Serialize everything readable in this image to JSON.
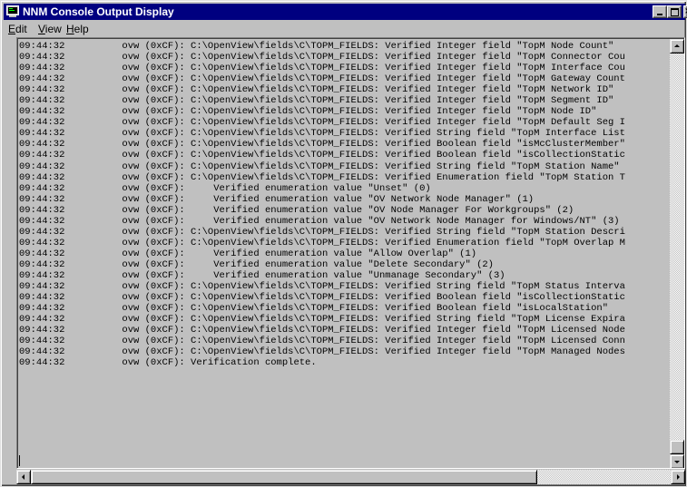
{
  "window": {
    "title": "NNM Console Output Display",
    "titlebar_color": "#000080"
  },
  "menu": {
    "items": [
      {
        "label": "Edit",
        "accel": "E"
      },
      {
        "label": "View",
        "accel": "V"
      },
      {
        "label": "Help",
        "accel": "H"
      }
    ]
  },
  "log_lines": [
    "09:44:32          ovw (0xCF): C:\\OpenView\\fields\\C\\TOPM_FIELDS: Verified Integer field \"TopM Node Count\"",
    "09:44:32          ovw (0xCF): C:\\OpenView\\fields\\C\\TOPM_FIELDS: Verified Integer field \"TopM Connector Cou",
    "09:44:32          ovw (0xCF): C:\\OpenView\\fields\\C\\TOPM_FIELDS: Verified Integer field \"TopM Interface Cou",
    "09:44:32          ovw (0xCF): C:\\OpenView\\fields\\C\\TOPM_FIELDS: Verified Integer field \"TopM Gateway Count",
    "09:44:32          ovw (0xCF): C:\\OpenView\\fields\\C\\TOPM_FIELDS: Verified Integer field \"TopM Network ID\"",
    "09:44:32          ovw (0xCF): C:\\OpenView\\fields\\C\\TOPM_FIELDS: Verified Integer field \"TopM Segment ID\"",
    "09:44:32          ovw (0xCF): C:\\OpenView\\fields\\C\\TOPM_FIELDS: Verified Integer field \"TopM Node ID\"",
    "09:44:32          ovw (0xCF): C:\\OpenView\\fields\\C\\TOPM_FIELDS: Verified Integer field \"TopM Default Seg I",
    "09:44:32          ovw (0xCF): C:\\OpenView\\fields\\C\\TOPM_FIELDS: Verified String field \"TopM Interface List",
    "09:44:32          ovw (0xCF): C:\\OpenView\\fields\\C\\TOPM_FIELDS: Verified Boolean field \"isMcClusterMember\"",
    "09:44:32          ovw (0xCF): C:\\OpenView\\fields\\C\\TOPM_FIELDS: Verified Boolean field \"isCollectionStatic",
    "09:44:32          ovw (0xCF): C:\\OpenView\\fields\\C\\TOPM_FIELDS: Verified String field \"TopM Station Name\"",
    "09:44:32          ovw (0xCF): C:\\OpenView\\fields\\C\\TOPM_FIELDS: Verified Enumeration field \"TopM Station T",
    "09:44:32          ovw (0xCF):     Verified enumeration value \"Unset\" (0)",
    "09:44:32          ovw (0xCF):     Verified enumeration value \"OV Network Node Manager\" (1)",
    "09:44:32          ovw (0xCF):     Verified enumeration value \"OV Node Manager For Workgroups\" (2)",
    "09:44:32          ovw (0xCF):     Verified enumeration value \"OV Network Node Manager for Windows/NT\" (3)",
    "09:44:32          ovw (0xCF): C:\\OpenView\\fields\\C\\TOPM_FIELDS: Verified String field \"TopM Station Descri",
    "09:44:32          ovw (0xCF): C:\\OpenView\\fields\\C\\TOPM_FIELDS: Verified Enumeration field \"TopM Overlap M",
    "09:44:32          ovw (0xCF):     Verified enumeration value \"Allow Overlap\" (1)",
    "09:44:32          ovw (0xCF):     Verified enumeration value \"Delete Secondary\" (2)",
    "09:44:32          ovw (0xCF):     Verified enumeration value \"Unmanage Secondary\" (3)",
    "09:44:32          ovw (0xCF): C:\\OpenView\\fields\\C\\TOPM_FIELDS: Verified String field \"TopM Status Interva",
    "09:44:32          ovw (0xCF): C:\\OpenView\\fields\\C\\TOPM_FIELDS: Verified Boolean field \"isCollectionStatic",
    "09:44:32          ovw (0xCF): C:\\OpenView\\fields\\C\\TOPM_FIELDS: Verified Boolean field \"isLocalStation\"",
    "09:44:32          ovw (0xCF): C:\\OpenView\\fields\\C\\TOPM_FIELDS: Verified String field \"TopM License Expira",
    "09:44:32          ovw (0xCF): C:\\OpenView\\fields\\C\\TOPM_FIELDS: Verified Integer field \"TopM Licensed Node",
    "09:44:32          ovw (0xCF): C:\\OpenView\\fields\\C\\TOPM_FIELDS: Verified Integer field \"TopM Licensed Conn",
    "09:44:32          ovw (0xCF): C:\\OpenView\\fields\\C\\TOPM_FIELDS: Verified Integer field \"TopM Managed Nodes",
    "09:44:32          ovw (0xCF): Verification complete."
  ],
  "icons": {
    "app": "terminal-window-icon",
    "minimize": "minimize-icon",
    "maximize": "maximize-icon",
    "close": "close-icon",
    "scroll_up": "arrow-up-icon",
    "scroll_down": "arrow-down-icon",
    "scroll_left": "arrow-left-icon",
    "scroll_right": "arrow-right-icon"
  }
}
